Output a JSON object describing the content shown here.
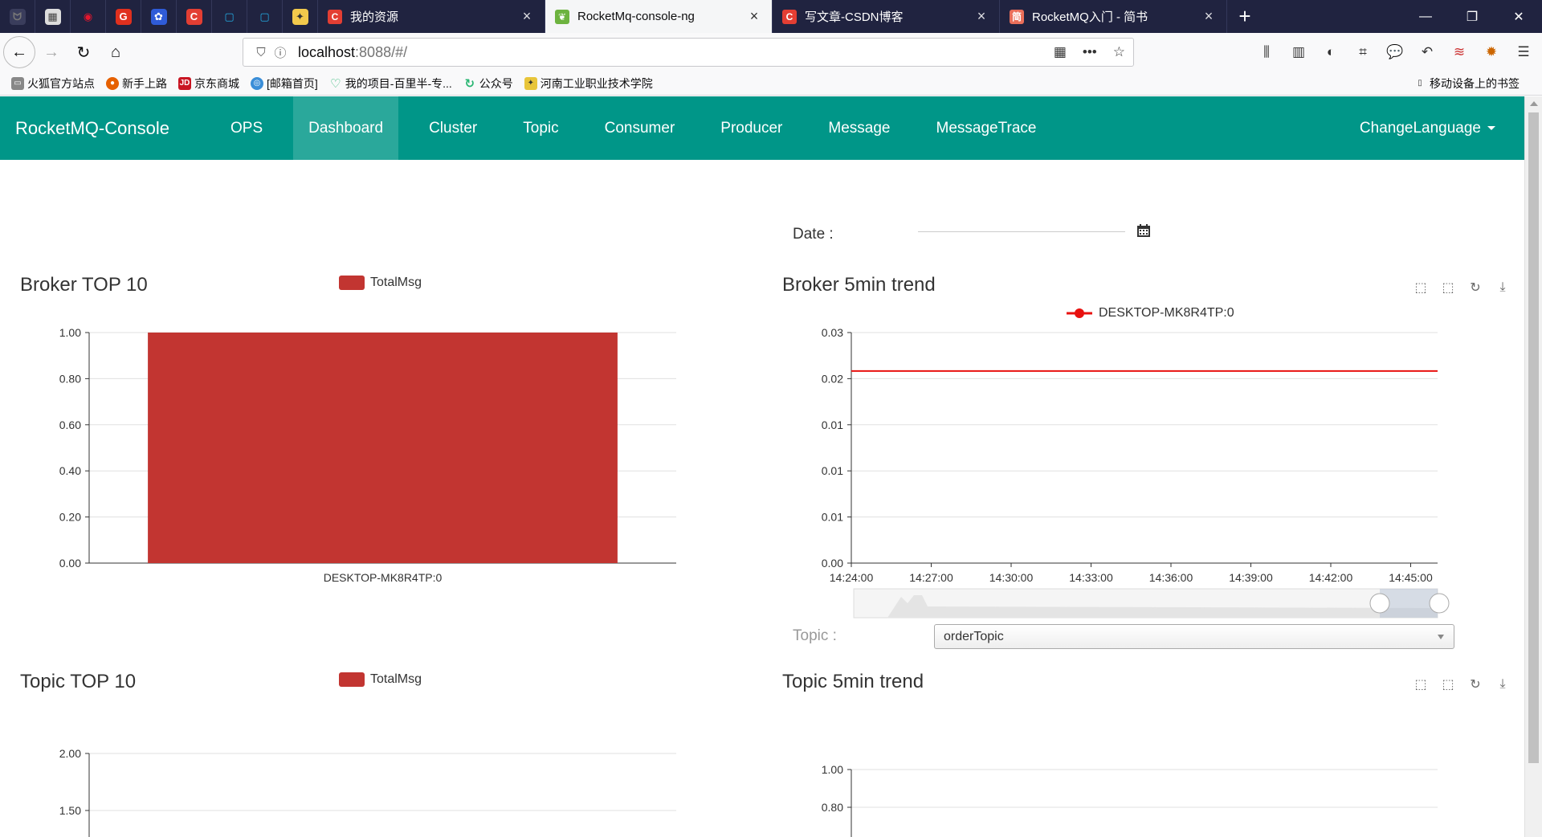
{
  "browser": {
    "tabs": [
      {
        "title": "我的资源",
        "icon": "csdn-icon"
      },
      {
        "title": "RocketMq-console-ng",
        "icon": "spring-leaf-icon",
        "active": true
      },
      {
        "title": "写文章-CSDN博客",
        "icon": "csdn-icon"
      },
      {
        "title": "RocketMQ入门 - 简书",
        "icon": "jianshu-icon"
      }
    ],
    "url_host": "localhost",
    "url_rest": ":8088/#/",
    "bookmarks": [
      "火狐官方站点",
      "新手上路",
      "京东商城",
      "[邮箱首页]",
      "我的项目-百里半-专...",
      "公众号",
      "河南工业职业技术学院"
    ],
    "mobile_bookmarks": "移动设备上的书签"
  },
  "app": {
    "brand": "RocketMQ-Console",
    "menu": [
      "OPS",
      "Dashboard",
      "Cluster",
      "Topic",
      "Consumer",
      "Producer",
      "Message",
      "MessageTrace"
    ],
    "active_menu": "Dashboard",
    "change_language": "ChangeLanguage"
  },
  "dashboard": {
    "date_label": "Date :",
    "topic_label": "Topic :",
    "topic_selected": "orderTopic",
    "broker_top10": {
      "title": "Broker TOP 10",
      "legend": "TotalMsg"
    },
    "broker_trend": {
      "title": "Broker 5min trend",
      "legend": "DESKTOP-MK8R4TP:0"
    },
    "topic_top10": {
      "title": "Topic TOP 10",
      "legend": "TotalMsg"
    },
    "topic_trend": {
      "title": "Topic 5min trend"
    }
  },
  "colors": {
    "header": "#009688",
    "bar": "#c23531",
    "trend_line": "#e8110f"
  },
  "chart_data": [
    {
      "type": "bar",
      "title": "Broker TOP 10",
      "legend": [
        "TotalMsg"
      ],
      "categories": [
        "DESKTOP-MK8R4TP:0"
      ],
      "values": [
        1.0
      ],
      "ylim": [
        0,
        1.0
      ],
      "yticks": [
        "0.00",
        "0.20",
        "0.40",
        "0.60",
        "0.80",
        "1.00"
      ],
      "grid": true
    },
    {
      "type": "line",
      "title": "Broker 5min trend",
      "series": [
        {
          "name": "DESKTOP-MK8R4TP:0",
          "values": [
            0.025,
            0.025
          ]
        }
      ],
      "x": [
        "14:24:00",
        "14:45:30"
      ],
      "xticks": [
        "14:24:00",
        "14:27:00",
        "14:30:00",
        "14:33:00",
        "14:36:00",
        "14:39:00",
        "14:42:00",
        "14:45:00"
      ],
      "yticks": [
        "0.00",
        "0.01",
        "0.01",
        "0.01",
        "0.02",
        "0.03"
      ],
      "ylim": [
        0,
        0.03
      ],
      "grid": true
    },
    {
      "type": "bar",
      "title": "Topic TOP 10",
      "legend": [
        "TotalMsg"
      ],
      "categories": [],
      "values": [],
      "yticks": [
        "1.50",
        "2.00"
      ],
      "grid": true
    },
    {
      "type": "line",
      "title": "Topic 5min trend",
      "series": [],
      "yticks": [
        "0.80",
        "1.00"
      ],
      "grid": true
    }
  ]
}
